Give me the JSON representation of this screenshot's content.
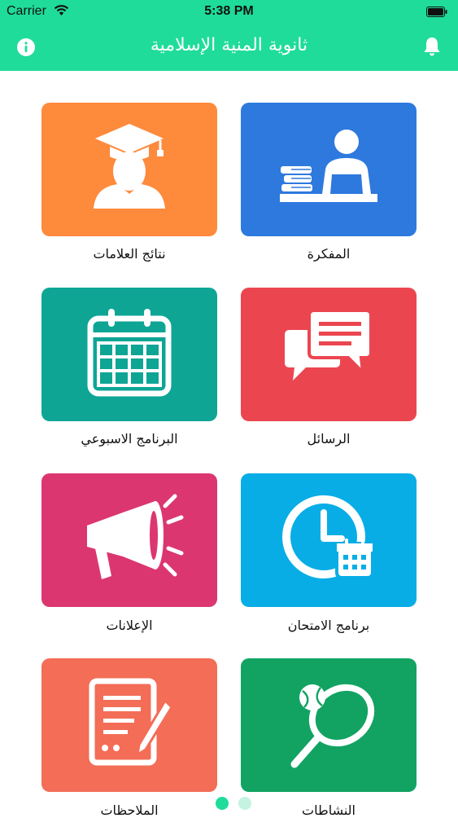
{
  "status_bar": {
    "carrier": "Carrier",
    "time": "5:38 PM"
  },
  "nav": {
    "title": "ثانوية المنية الإسلامية"
  },
  "colors": {
    "header": "#1fdc9a",
    "grades": "#fe8a3c",
    "notebook": "#2e79de",
    "schedule": "#0ea595",
    "messages": "#eb4650",
    "announcements": "#dc3671",
    "exam": "#08ade6",
    "notes": "#f36d57",
    "activities": "#12a363"
  },
  "tiles": [
    {
      "id": "grades",
      "label": "نتائج العلامات",
      "icon": "graduate-icon"
    },
    {
      "id": "notebook",
      "label": "المفكرة",
      "icon": "student-desk-icon"
    },
    {
      "id": "schedule",
      "label": "البرنامج الاسبوعي",
      "icon": "calendar-icon"
    },
    {
      "id": "messages",
      "label": "الرسائل",
      "icon": "chat-bubbles-icon"
    },
    {
      "id": "announcements",
      "label": "الإعلانات",
      "icon": "megaphone-icon"
    },
    {
      "id": "exam",
      "label": "برنامج الامتحان",
      "icon": "clock-calendar-icon"
    },
    {
      "id": "notes",
      "label": "الملاحظات",
      "icon": "document-pencil-icon"
    },
    {
      "id": "activities",
      "label": "النشاطات",
      "icon": "tennis-icon"
    }
  ],
  "pager": {
    "pages": 2,
    "current": 1
  }
}
